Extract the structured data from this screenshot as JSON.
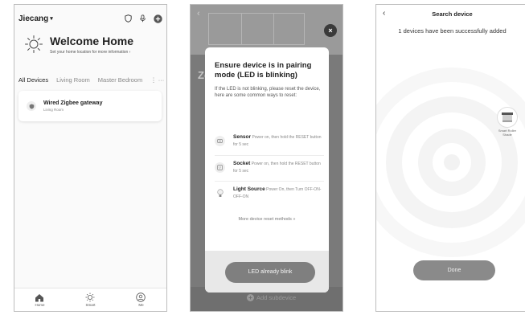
{
  "home": {
    "home_name": "Jiecang",
    "welcome_title": "Welcome Home",
    "welcome_sub": "Set your home location for more information",
    "tabs": [
      "All Devices",
      "Living Room",
      "Master Bedroom",
      "⋮ ···"
    ],
    "device": {
      "name": "Wired Zigbee gateway",
      "room": "Living Room"
    },
    "nav": [
      "Home",
      "Smart",
      "Me"
    ]
  },
  "pairing": {
    "bg_title": "Ze",
    "dialog_title": "Ensure device is in pairing mode (LED is blinking)",
    "dialog_desc": "If the LED is not blinking, please reset the device, here are some common ways to reset:",
    "items": [
      {
        "name": "Sensor",
        "text": "Power on, then hold the RESET button for 5 sec",
        "icon": "sensor-icon"
      },
      {
        "name": "Socket",
        "text": "Power on, then hold the RESET button for 5 sec",
        "icon": "socket-icon"
      },
      {
        "name": "Light Source",
        "text": "Power On, then Turn OFF-ON-OFF-ON",
        "icon": "bulb-icon"
      }
    ],
    "more_methods": "More device reset methods »",
    "led_button": "LED already blink",
    "add_subdevice": "Add subdevice",
    "close": "×"
  },
  "search": {
    "title": "Search device",
    "status": "1 devices have been successfully added",
    "device_name": "Smart Roller Shade",
    "done_button": "Done"
  },
  "colors": {
    "overlay": "#7a7a7a",
    "button_gray": "#7f7f7f",
    "ring_gray": "#f2f2f2"
  }
}
